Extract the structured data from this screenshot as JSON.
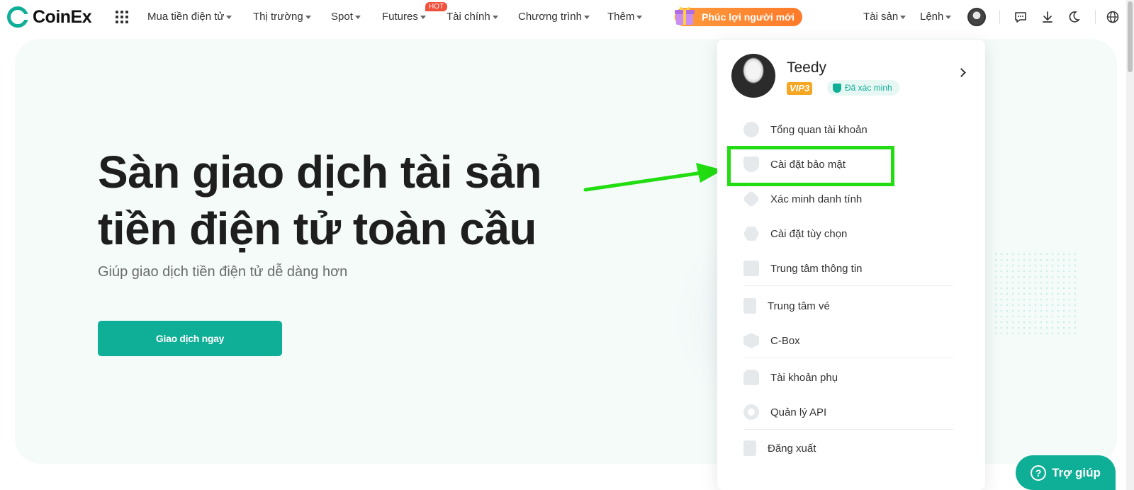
{
  "brand": {
    "name": "CoinEx",
    "accent": "#0fae96"
  },
  "nav": {
    "items": [
      {
        "label": "Mua tiền điện tử"
      },
      {
        "label": "Thị trường"
      },
      {
        "label": "Spot"
      },
      {
        "label": "Futures"
      },
      {
        "label": "Tài chính"
      },
      {
        "label": "Chương trình"
      },
      {
        "label": "Thêm"
      }
    ],
    "hot_badge": "HOT",
    "promo": "Phúc lợi người mới",
    "assets": "Tài sản",
    "orders": "Lệnh"
  },
  "hero": {
    "title_line1": "Sàn giao dịch tài sản",
    "title_line2": "tiền điện tử toàn cầu",
    "subtitle": "Giúp giao dịch tiền điện tử dễ dàng hơn",
    "cta": "Giao dịch ngay"
  },
  "dropdown": {
    "user_name": "Teedy",
    "vip": "VIP3",
    "verified": "Đã xác minh",
    "items": [
      {
        "label": "Tổng quan tài khoản",
        "icon": "pie-chart-icon"
      },
      {
        "label": "Cài đặt bảo mật",
        "icon": "shield-icon"
      },
      {
        "label": "Xác minh danh tính",
        "icon": "id-diamond-icon"
      },
      {
        "label": "Cài đặt tùy chọn",
        "icon": "hexagon-settings-icon"
      },
      {
        "label": "Trung tâm thông tin",
        "icon": "message-center-icon"
      },
      {
        "label": "Trung tâm vé",
        "icon": "ticket-icon"
      },
      {
        "label": "C-Box",
        "icon": "box-icon"
      },
      {
        "label": "Tài khoản phụ",
        "icon": "sub-account-icon"
      },
      {
        "label": "Quản lý API",
        "icon": "api-icon"
      },
      {
        "label": "Đăng xuất",
        "icon": "logout-icon"
      }
    ]
  },
  "help": {
    "label": "Trợ giúp"
  },
  "annotation": {
    "highlight_color": "#22dd11"
  }
}
